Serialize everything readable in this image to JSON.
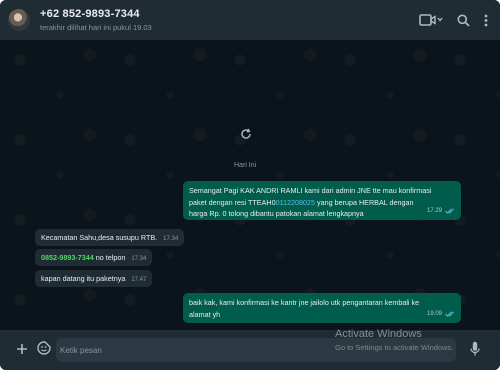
{
  "header": {
    "contact_name": "+62 852-9893-7344",
    "status": "terakhir dilihat hari ini pukul 19.03",
    "icons": [
      "video-icon",
      "chevron-down-icon",
      "search-icon",
      "menu-dots-icon"
    ]
  },
  "chat": {
    "date_separator": "Hari Ini",
    "messages": [
      {
        "direction": "out",
        "line1": "Semangat Pagi KAK ANDRI RAMLI kami dari admin JNE tte mau konfirmasi",
        "line2_before": "paket dengan resi TTEAH0",
        "line2_highlight": "0112208025",
        "line2_after": " yang berupa HERBAL dengan",
        "line3": "harga Rp. 0 tolong dibantu patokan alamat lengkapnya",
        "time": "17.29"
      },
      {
        "direction": "in",
        "text": "Kecamatan Sahu,desa susupu RTB.",
        "time": "17.34"
      },
      {
        "direction": "in",
        "phone": "0852-9893-7344",
        "text": " no telpon",
        "time": "17.34"
      },
      {
        "direction": "in",
        "text": "kapan datang itu paketnya",
        "time": "17.47"
      },
      {
        "direction": "out",
        "line1": "baik kak, kami konfirmasi ke kantr jne jailolo utk pengantaran kembali ke",
        "line2": "alamat yh",
        "time": "19.09"
      }
    ]
  },
  "composer": {
    "placeholder": "Ketik pesan"
  },
  "overlay": {
    "title": "Activate Windows",
    "subtitle": "Go to Settings to activate Windows."
  },
  "colors": {
    "background": "#0b141a",
    "panel": "#1f2c33",
    "outgoing_bubble": "#005c4b",
    "incoming_bubble": "#202c33",
    "read_ticks": "#53bdeb",
    "phone_link": "#53d36d"
  }
}
